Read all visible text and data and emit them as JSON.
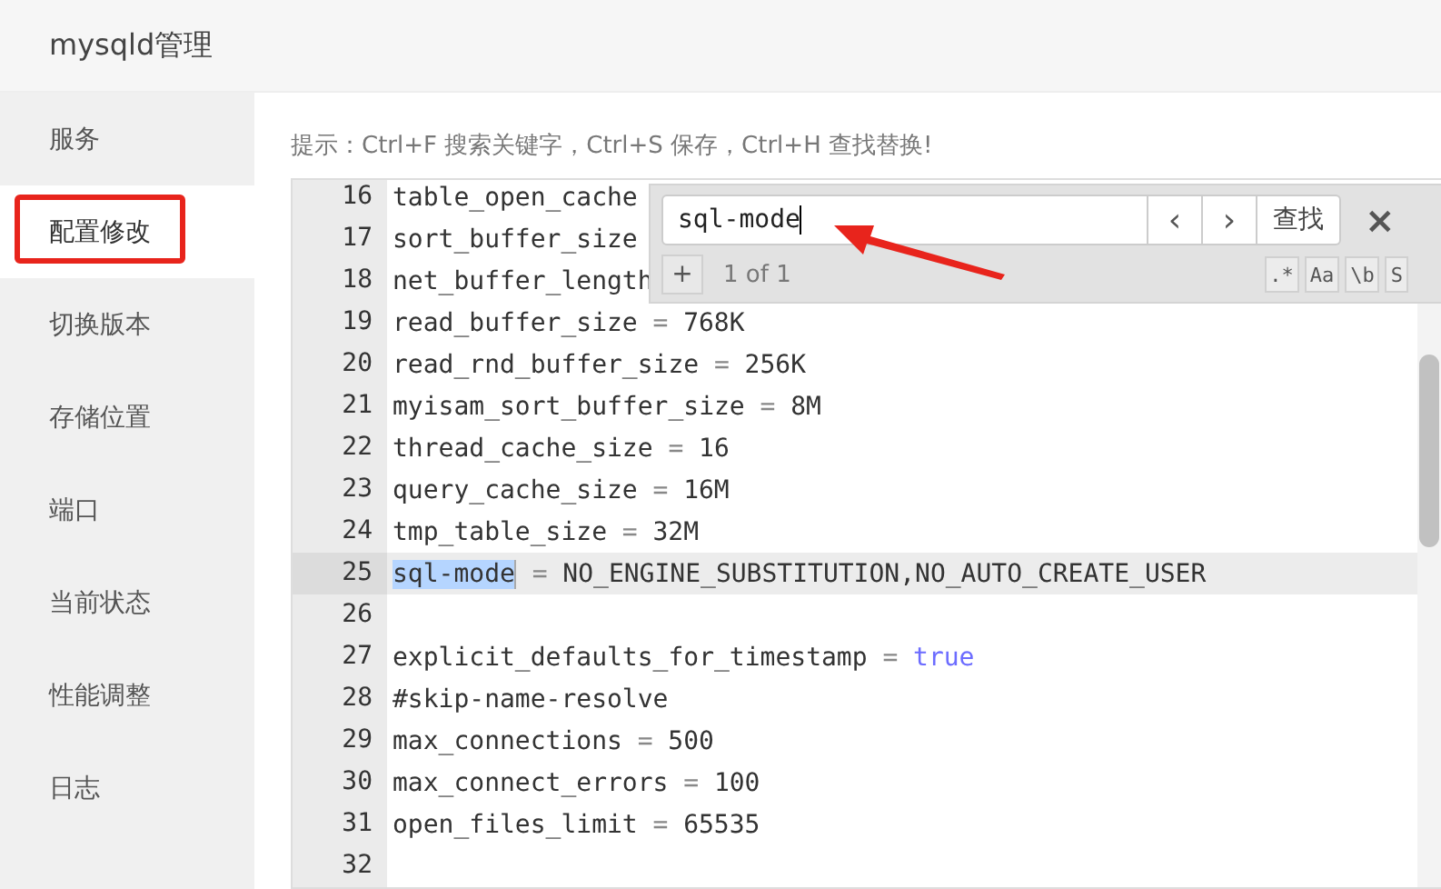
{
  "window": {
    "title": "mysqld管理"
  },
  "sidebar": {
    "items": [
      {
        "label": "服务",
        "selected": false
      },
      {
        "label": "配置修改",
        "selected": true
      },
      {
        "label": "切换版本",
        "selected": false
      },
      {
        "label": "存储位置",
        "selected": false
      },
      {
        "label": "端口",
        "selected": false
      },
      {
        "label": "当前状态",
        "selected": false
      },
      {
        "label": "性能调整",
        "selected": false
      },
      {
        "label": "日志",
        "selected": false
      }
    ]
  },
  "hint": "提示：Ctrl+F 搜索关键字，Ctrl+S 保存，Ctrl+H 查找替换!",
  "editor": {
    "lines": [
      {
        "number": "16",
        "key": "table_open_cache",
        "active": false
      },
      {
        "number": "17",
        "key": "sort_buffer_size",
        "active": false
      },
      {
        "number": "18",
        "key": "net_buffer_length",
        "active": false
      },
      {
        "number": "19",
        "key": "read_buffer_size",
        "op": "=",
        "value": "768K",
        "keyword": false,
        "active": false
      },
      {
        "number": "20",
        "key": "read_rnd_buffer_size",
        "op": "=",
        "value": "256K",
        "keyword": false,
        "active": false
      },
      {
        "number": "21",
        "key": "myisam_sort_buffer_size",
        "op": "=",
        "value": "8M",
        "keyword": false,
        "active": false
      },
      {
        "number": "22",
        "key": "thread_cache_size",
        "op": "=",
        "value": "16",
        "keyword": false,
        "active": false
      },
      {
        "number": "23",
        "key": "query_cache_size",
        "op": "=",
        "value": "16M",
        "keyword": false,
        "active": false
      },
      {
        "number": "24",
        "key": "tmp_table_size",
        "op": "=",
        "value": "32M",
        "keyword": false,
        "active": false
      },
      {
        "number": "25",
        "key": "sql-mode",
        "match": true,
        "op": "=",
        "value": "NO_ENGINE_SUBSTITUTION,NO_AUTO_CREATE_USER",
        "keyword": false,
        "active": true
      },
      {
        "number": "26",
        "active": false
      },
      {
        "number": "27",
        "key": "explicit_defaults_for_timestamp",
        "op": "=",
        "value": "true",
        "keyword": true,
        "active": false
      },
      {
        "number": "28",
        "key": "#skip-name-resolve",
        "active": false
      },
      {
        "number": "29",
        "key": "max_connections",
        "op": "=",
        "value": "500",
        "keyword": false,
        "active": false
      },
      {
        "number": "30",
        "key": "max_connect_errors",
        "op": "=",
        "value": "100",
        "keyword": false,
        "active": false
      },
      {
        "number": "31",
        "key": "open_files_limit",
        "op": "=",
        "value": "65535",
        "keyword": false,
        "active": false
      },
      {
        "number": "32",
        "active": false
      }
    ]
  },
  "search": {
    "value": "sql-mode",
    "prev": "‹",
    "next": "›",
    "find_button": "查找",
    "close": "×",
    "add": "+",
    "count": "1 of 1",
    "options": [
      ".*",
      "Aa",
      "\\b",
      "S"
    ]
  }
}
